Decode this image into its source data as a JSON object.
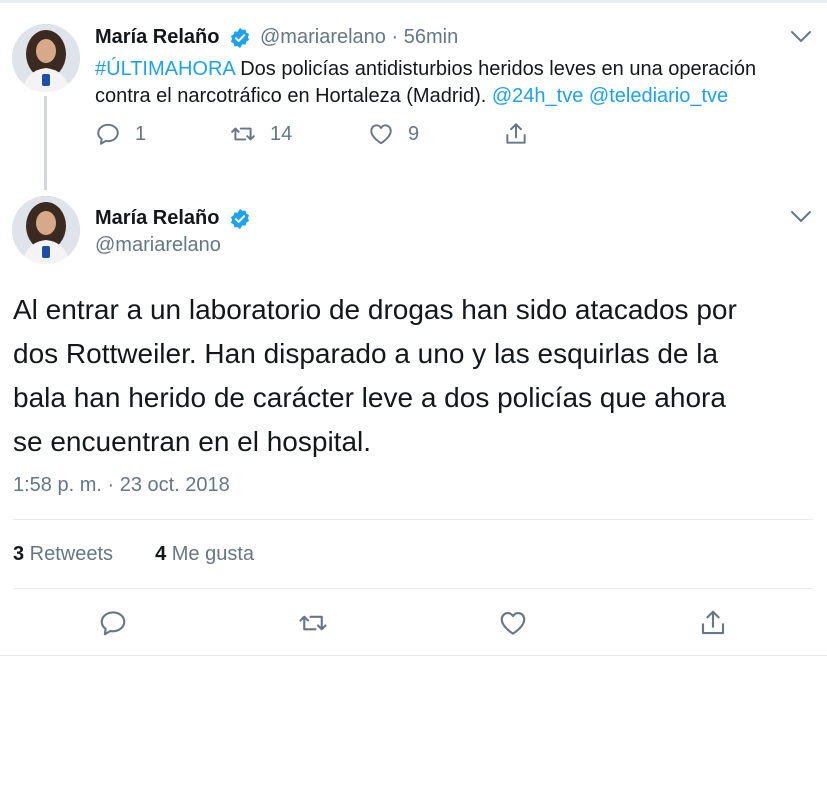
{
  "tweet1": {
    "author": "María Relaño",
    "handle": "@mariarelano",
    "separator": "·",
    "time": "56min",
    "hashtag": "#ÚLTIMAHORA",
    "text_part1": " Dos policías antidisturbios heridos leves en una operación",
    "text_part2": "contra el narcotráfico en Hortaleza (Madrid). ",
    "mention1": "@24h_tve",
    "mention2": "@telediario_tve",
    "replies": "1",
    "retweets": "14",
    "likes": "9"
  },
  "tweet2": {
    "author": "María Relaño",
    "handle": "@mariarelano",
    "body_lines": [
      "Al entrar a un laboratorio de drogas han sido atacados por",
      "dos Rottweiler. Han disparado a uno y las esquirlas de la",
      "bala han herido de carácter leve a dos policías que ahora",
      "se encuentran en el hospital."
    ],
    "timestamp": "1:58 p. m. · 23 oct. 2018",
    "retweet_count": "3",
    "retweet_label": " Retweets",
    "like_count": "4",
    "like_label": " Me gusta"
  },
  "colors": {
    "link": "#1da1f2",
    "muted": "#657786",
    "text": "#14171a",
    "verified": "#1da1f2"
  },
  "icons": [
    "reply-icon",
    "retweet-icon",
    "like-icon",
    "share-icon",
    "verified-icon",
    "chevron-down-icon"
  ]
}
